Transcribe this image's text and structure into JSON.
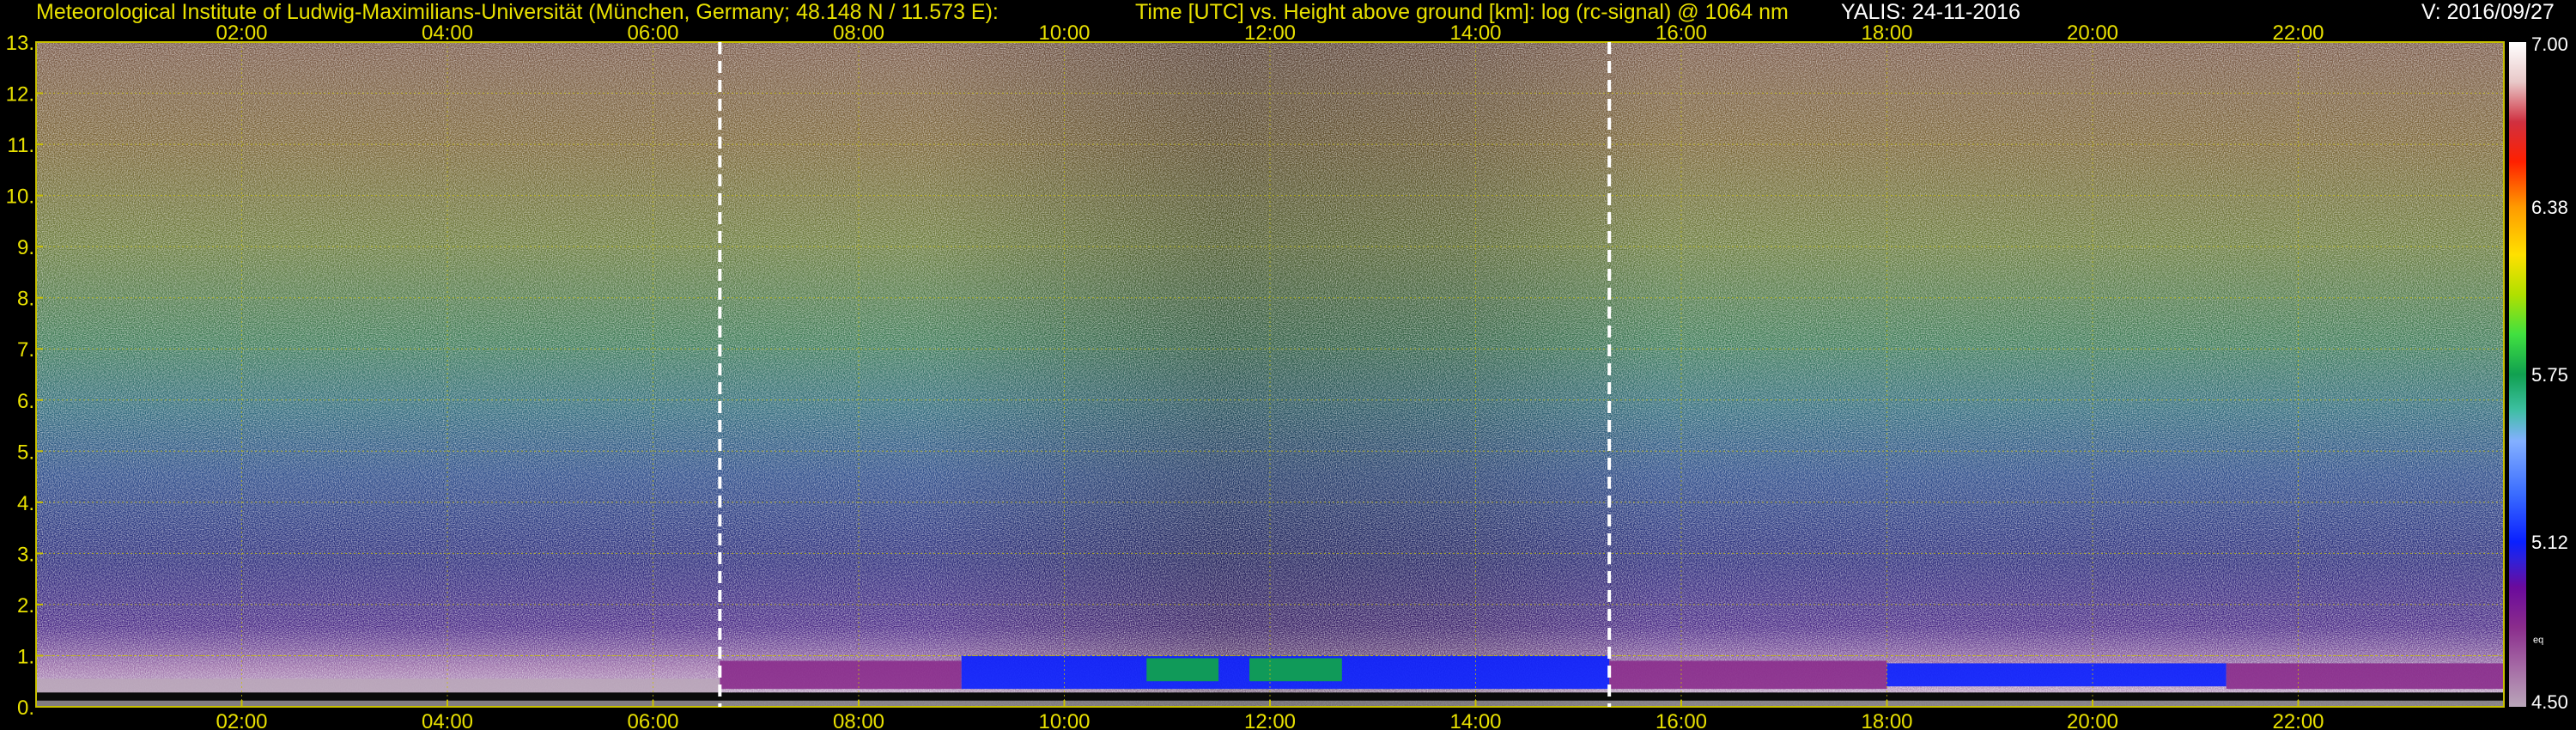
{
  "header": {
    "institute": "Meteorological Institute of Ludwig-Maximilians-Universität (München, Germany; 48.148 N / 11.573 E):",
    "axes_description": "Time [UTC] vs. Height above ground [km]: log (rc-signal) @ 1064 nm",
    "instrument_date": "YALIS: 24-11-2016",
    "version": "V: 2016/09/27"
  },
  "colors": {
    "header_text": "#e8e000",
    "grid": "#c8c000",
    "marker_line": "#ffffff",
    "background": "#000000"
  },
  "chart_data": {
    "type": "heatmap",
    "x_axis": {
      "quantity": "Time [UTC]",
      "range_hours": [
        0,
        24
      ],
      "tick_labels": [
        "02:00",
        "04:00",
        "06:00",
        "08:00",
        "10:00",
        "12:00",
        "14:00",
        "16:00",
        "18:00",
        "20:00",
        "22:00"
      ],
      "tick_hours": [
        2,
        4,
        6,
        8,
        10,
        12,
        14,
        16,
        18,
        20,
        22
      ],
      "labels_top_and_bottom": true
    },
    "y_axis": {
      "quantity": "Height above ground [km]",
      "range": [
        0,
        13
      ],
      "tick_labels": [
        "0.",
        "1.",
        "2.",
        "3.",
        "4.",
        "5.",
        "6.",
        "7.",
        "8.",
        "9.",
        "10.",
        "11.",
        "12.",
        "13."
      ]
    },
    "grid": true,
    "vertical_markers_utc_hours": [
      6.65,
      15.3
    ],
    "colorbar": {
      "range": [
        4.5,
        7.0
      ],
      "tick_labels": [
        "7.00",
        "6.38",
        "5.75",
        "5.12",
        "4.50"
      ],
      "tick_values": [
        7.0,
        6.38,
        5.75,
        5.12,
        4.5
      ],
      "note": "eq",
      "stops": [
        {
          "v": 4.5,
          "c": "#b9a6b9"
        },
        {
          "v": 4.65,
          "c": "#a56aa5"
        },
        {
          "v": 4.8,
          "c": "#8a2c8c"
        },
        {
          "v": 4.95,
          "c": "#6a0a9c"
        },
        {
          "v": 5.05,
          "c": "#3020d8"
        },
        {
          "v": 5.12,
          "c": "#0a20ff"
        },
        {
          "v": 5.3,
          "c": "#3a6cff"
        },
        {
          "v": 5.5,
          "c": "#84b0ff"
        },
        {
          "v": 5.62,
          "c": "#3cbfa0"
        },
        {
          "v": 5.75,
          "c": "#10a050"
        },
        {
          "v": 5.9,
          "c": "#40e040"
        },
        {
          "v": 6.05,
          "c": "#b0e000"
        },
        {
          "v": 6.2,
          "c": "#ffe000"
        },
        {
          "v": 6.38,
          "c": "#ff9a00"
        },
        {
          "v": 6.55,
          "c": "#ff2000"
        },
        {
          "v": 6.7,
          "c": "#d03040"
        },
        {
          "v": 6.85,
          "c": "#e8c8c8"
        },
        {
          "v": 7.0,
          "c": "#ffffff"
        }
      ]
    },
    "features": {
      "boundary_layer_top_km": 1.0,
      "aerosol_layer": [
        {
          "start": 6.65,
          "end": 9.0,
          "base_km": 0.35,
          "top_km": 0.9,
          "value": 4.85
        },
        {
          "start": 9.0,
          "end": 15.3,
          "base_km": 0.35,
          "top_km": 1.0,
          "value": 5.15
        },
        {
          "start": 15.3,
          "end": 18.0,
          "base_km": 0.35,
          "top_km": 0.9,
          "value": 4.85
        },
        {
          "start": 18.0,
          "end": 21.3,
          "base_km": 0.4,
          "top_km": 0.85,
          "value": 5.1
        },
        {
          "start": 21.3,
          "end": 24.0,
          "base_km": 0.35,
          "top_km": 0.85,
          "value": 4.85
        }
      ],
      "strong_returns": [
        {
          "start": 10.8,
          "end": 11.5,
          "base_km": 0.5,
          "top_km": 0.95,
          "value": 5.8
        },
        {
          "start": 11.8,
          "end": 12.7,
          "base_km": 0.5,
          "top_km": 0.95,
          "value": 5.8
        }
      ]
    }
  }
}
